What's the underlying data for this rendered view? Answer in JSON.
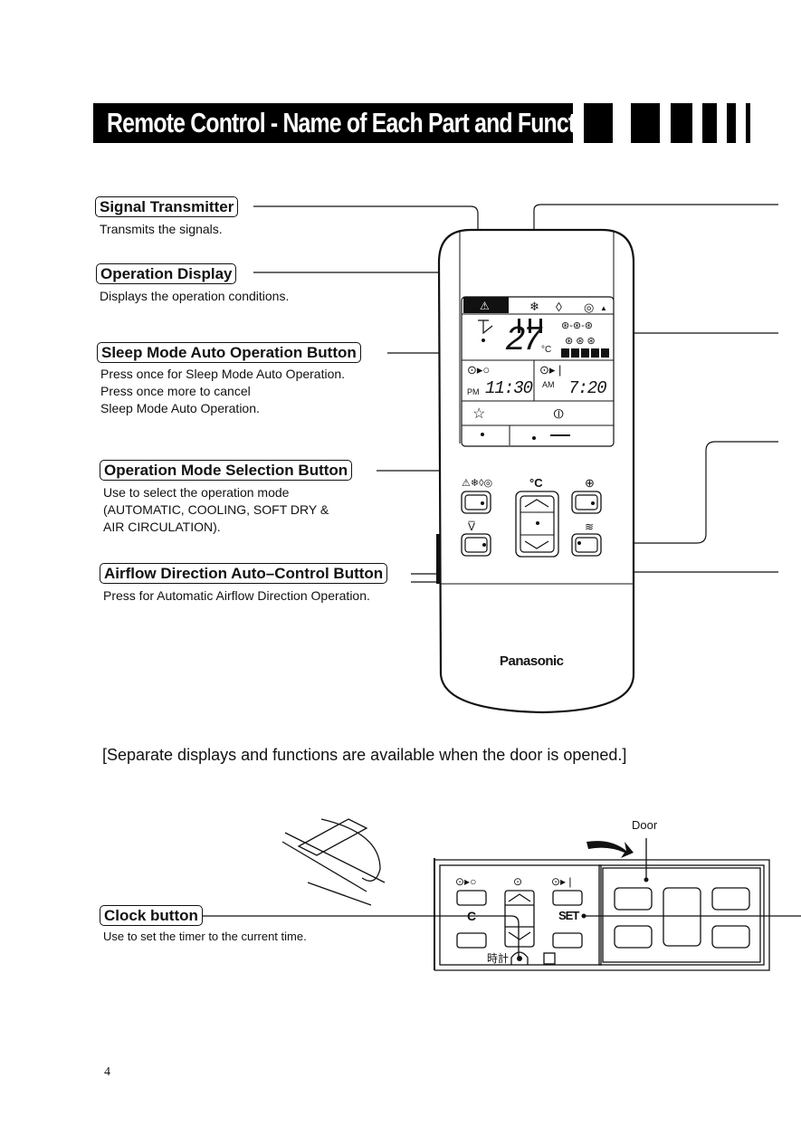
{
  "page": {
    "title": "Remote Control - Name of Each Part and Functions",
    "page_number": "4"
  },
  "callouts_left": [
    {
      "label": "Signal Transmitter",
      "desc": [
        "Transmits the signals."
      ]
    },
    {
      "label": "Operation Display",
      "desc": [
        "Displays the operation conditions."
      ]
    },
    {
      "label": "Sleep Mode Auto Operation Button",
      "desc": [
        "Press once for Sleep Mode Auto Operation.",
        "Press once more to cancel",
        "Sleep Mode Auto Operation."
      ]
    },
    {
      "label": "Operation Mode Selection Button",
      "desc": [
        "Use to select the operation mode",
        "(AUTOMATIC, COOLING, SOFT DRY &",
        "AIR CIRCULATION)."
      ]
    },
    {
      "label": "Airflow Direction Auto–Control Button",
      "desc": [
        "Press for Automatic Airflow Direction Operation."
      ]
    }
  ],
  "remote": {
    "brand": "Panasonic",
    "display": {
      "temperature": "27",
      "temp_unit": "°C",
      "off_timer_prefix": "PM",
      "off_timer_time": "11:30",
      "on_timer_prefix": "AM",
      "on_timer_time": "7:20",
      "fan_bars": 5
    },
    "buttons": {
      "temp_label": "°C"
    }
  },
  "door_note": "[Separate displays and functions are available when the door is opened.]",
  "door_panel": {
    "door_label": "Door",
    "c_label": "C",
    "set_label": "SET",
    "clock_jp_label": "時計"
  },
  "callouts_bottom": [
    {
      "label": "Clock button",
      "desc": [
        "Use to set the timer to the current time."
      ]
    }
  ]
}
